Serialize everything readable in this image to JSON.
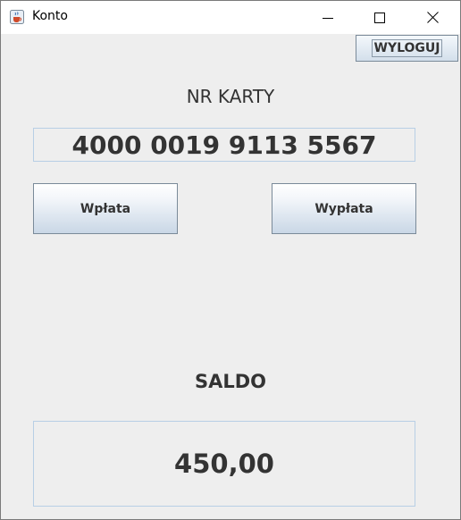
{
  "window": {
    "title": "Konto",
    "app_icon": "java-cup-icon",
    "controls": [
      "minimize-icon",
      "maximize-icon",
      "close-icon"
    ]
  },
  "header": {
    "logout_label": "WYLOGUJ"
  },
  "card": {
    "label": "NR KARTY",
    "number": "4000 0019 9113 5567"
  },
  "actions": {
    "deposit_label": "Wpłata",
    "withdraw_label": "Wypłata"
  },
  "balance": {
    "label": "SALDO",
    "value": "450,00"
  },
  "colors": {
    "panel_bg": "#eeeeee",
    "text": "#333333",
    "field_border": "#b8cfe5",
    "button_gradient_bottom": "#c9d7e6"
  }
}
